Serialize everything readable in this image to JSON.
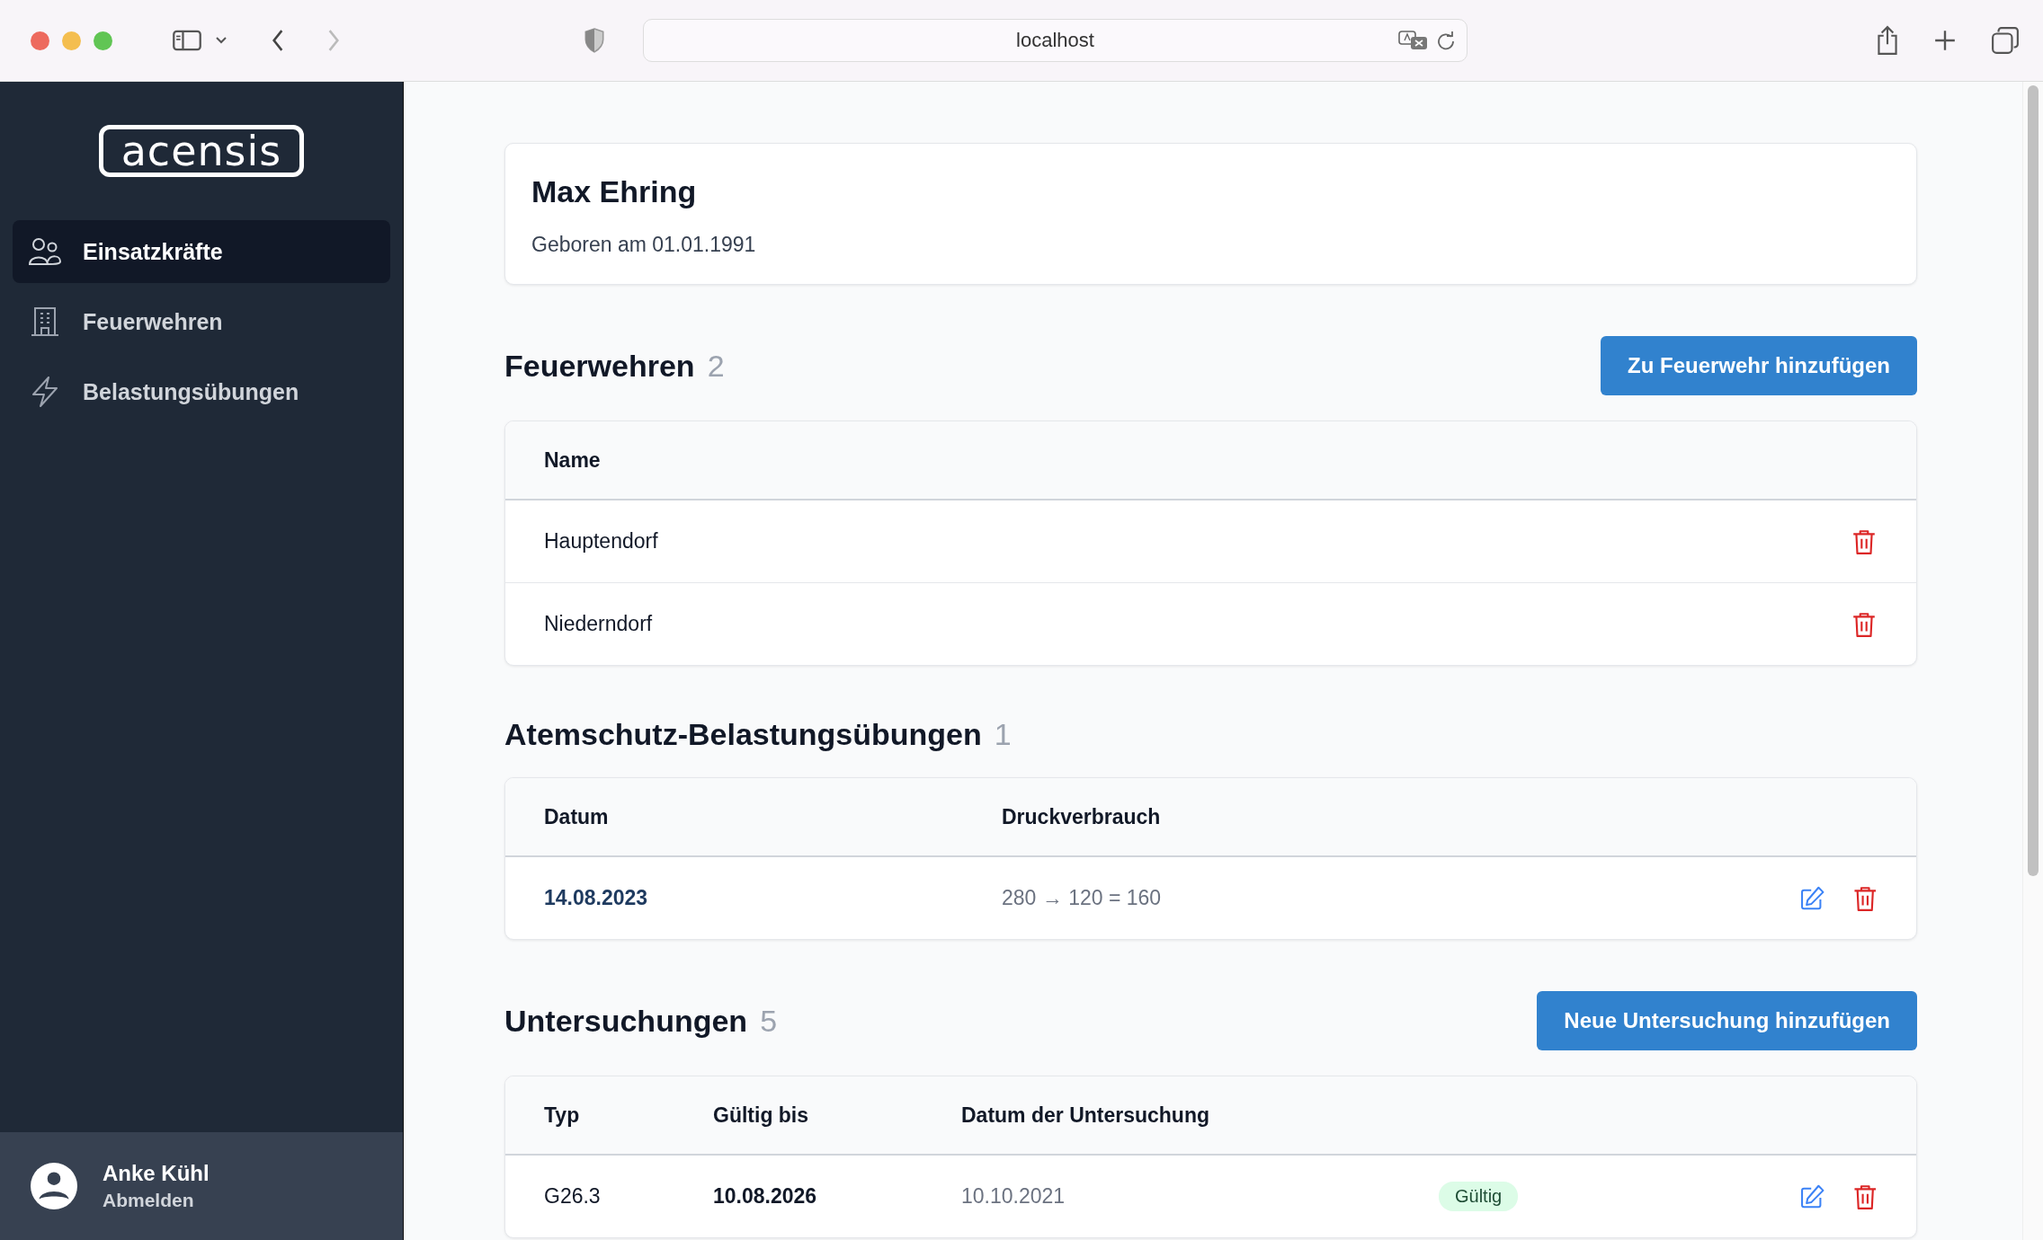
{
  "browser": {
    "url": "localhost",
    "back_disabled": false,
    "forward_disabled": true
  },
  "sidebar": {
    "logo": "acensis",
    "items": [
      {
        "label": "Einsatzkräfte",
        "selected": true
      },
      {
        "label": "Feuerwehren",
        "selected": false
      },
      {
        "label": "Belastungsübungen",
        "selected": false
      }
    ],
    "user": {
      "name": "Anke Kühl",
      "action": "Abmelden"
    }
  },
  "person": {
    "name": "Max Ehring",
    "birth": "Geboren am 01.01.1991"
  },
  "sections": [
    {
      "title": "Feuerwehren",
      "count": "2",
      "button": "Zu Feuerwehr hinzufügen",
      "columns": [
        "Name"
      ],
      "rows": [
        {
          "cells": [
            {
              "kind": "plain",
              "text": "Hauptendorf"
            }
          ],
          "editable": false
        },
        {
          "cells": [
            {
              "kind": "plain",
              "text": "Niederndorf"
            }
          ],
          "editable": false
        }
      ]
    },
    {
      "title": "Atemschutz-Belastungsübungen",
      "count": "1",
      "columns": [
        "Datum",
        "Druckverbrauch"
      ],
      "rows": [
        {
          "cells": [
            {
              "kind": "link",
              "text": "14.08.2023"
            },
            {
              "kind": "muted",
              "text": "280 → 120 = 160"
            }
          ],
          "editable": true
        }
      ]
    },
    {
      "title": "Untersuchungen",
      "count": "5",
      "button": "Neue Untersuchung hinzufügen",
      "columns": [
        "Typ",
        "Gültig bis",
        "Datum der Untersuchung"
      ],
      "rows": [
        {
          "cells": [
            {
              "kind": "plain",
              "text": "G26.3"
            },
            {
              "kind": "bold",
              "text": "10.08.2026"
            },
            {
              "kind": "muted",
              "text": "10.10.2021"
            },
            {
              "kind": "badge",
              "text": "Gültig",
              "color": "#dcfce7"
            }
          ],
          "editable": true
        }
      ]
    }
  ]
}
